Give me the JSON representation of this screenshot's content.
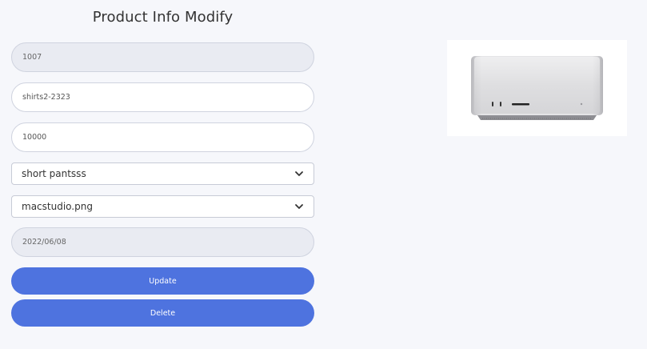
{
  "form": {
    "title": "Product Info Modify",
    "product_id": "1007",
    "product_name": "shirts2-2323",
    "price": "10000",
    "category_selected": "short pantsss",
    "image_selected": "macstudio.png",
    "date": "2022/06/08",
    "update_label": "Update",
    "delete_label": "Delete"
  },
  "preview": {
    "icon": "product-image-mac-studio"
  },
  "colors": {
    "primary": "#4e73df",
    "background": "#f6f7fb",
    "disabled_field": "#e9ebf2"
  }
}
